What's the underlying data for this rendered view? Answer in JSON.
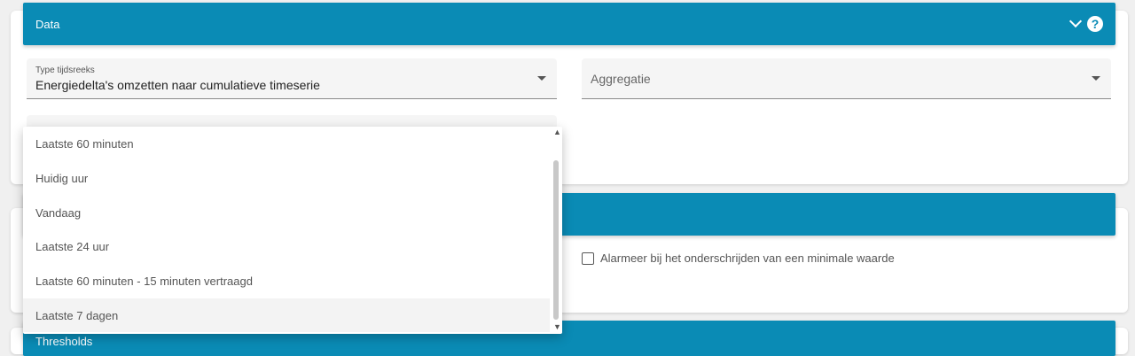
{
  "data_panel": {
    "title": "Data",
    "type_select": {
      "label": "Type tijdsreeks",
      "value": "Energiedelta's omzetten naar cumulatieve timeserie"
    },
    "aggregation_select": {
      "placeholder": "Aggregatie"
    }
  },
  "dropdown": {
    "options": [
      "Laatste 60 minuten",
      "Huidig uur",
      "Vandaag",
      "Laatste 24 uur",
      "Laatste 60 minuten - 15 minuten vertraagd",
      "Laatste 7 dagen"
    ],
    "highlighted_index": 5
  },
  "alarm_panel": {
    "min_alarm_label": "Alarmeer bij het onderschrijden van een minimale waarde",
    "min_alarm_checked": false
  },
  "thresholds_panel": {
    "title": "Thresholds"
  },
  "colors": {
    "accent": "#0a8bb5"
  }
}
